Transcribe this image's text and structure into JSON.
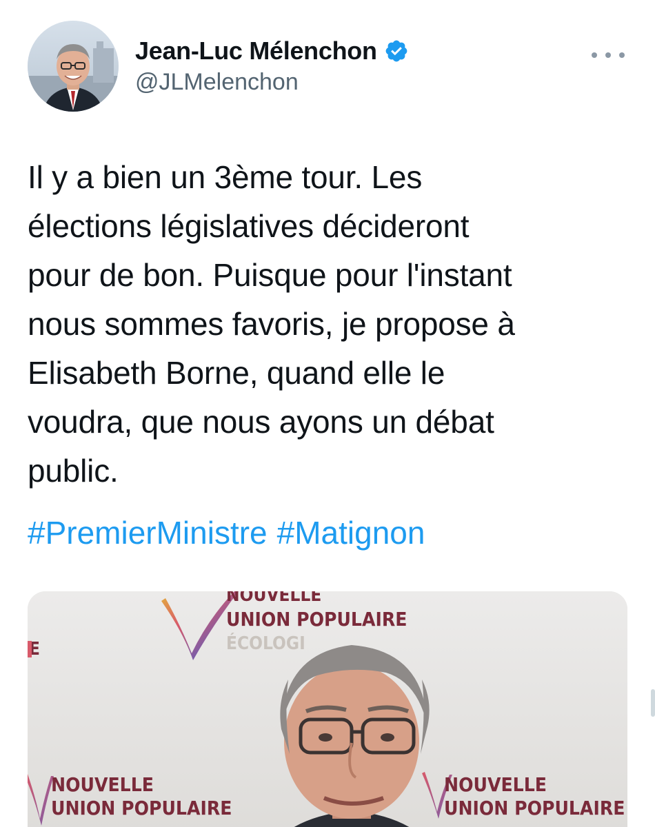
{
  "author": {
    "display_name": "Jean-Luc Mélenchon",
    "handle": "@JLMelenchon",
    "verified": true,
    "avatar_icon": "profile-photo"
  },
  "tweet": {
    "text": "Il y a bien un 3ème tour. Les\nélections législatives décideront\npour de bon. Puisque pour l'instant\nnous sommes favoris, je propose à\nElisabeth Borne, quand elle le\nvoudra, que nous ayons un débat\npublic.",
    "hashtags": [
      "#PremierMinistre",
      "#Matignon"
    ]
  },
  "media": {
    "banner_top_line1": "NOUVELLE",
    "banner_top_line2": "UNION POPULAIRE",
    "banner_top_line3": "ÉCOLOGI",
    "banner_left_fragment": "E",
    "banner_bottom_left_line1": "NOUVELLE",
    "banner_bottom_left_line2": "UNION POPULAIRE",
    "banner_bottom_right_line1": "NOUVELLE",
    "banner_bottom_right_line2": "UNION POPULAIRE"
  },
  "colors": {
    "link": "#1d9bf0",
    "text": "#0f1419",
    "secondary": "#536471",
    "verified": "#1d9bf0",
    "banner_text": "#7a2a3a"
  },
  "icons": {
    "verified": "verified-badge-icon",
    "more": "more-options-icon"
  }
}
